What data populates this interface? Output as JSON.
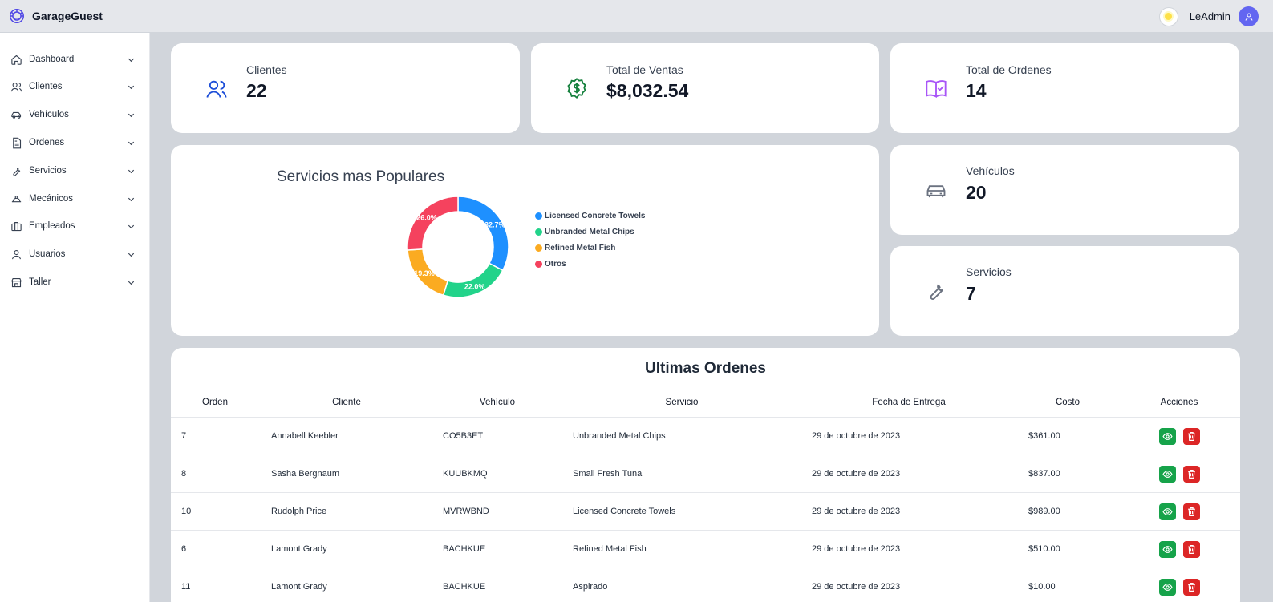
{
  "app": {
    "name": "GarageGuest"
  },
  "header": {
    "user_name": "LeAdmin"
  },
  "sidebar": {
    "items": [
      {
        "label": "Dashboard",
        "icon": "home-icon"
      },
      {
        "label": "Clientes",
        "icon": "users-icon"
      },
      {
        "label": "Vehículos",
        "icon": "car-icon"
      },
      {
        "label": "Ordenes",
        "icon": "document-icon"
      },
      {
        "label": "Servicios",
        "icon": "wrench-icon"
      },
      {
        "label": "Mecánicos",
        "icon": "hard-hat-icon"
      },
      {
        "label": "Empleados",
        "icon": "briefcase-icon"
      },
      {
        "label": "Usuarios",
        "icon": "user-icon"
      },
      {
        "label": "Taller",
        "icon": "store-icon"
      }
    ]
  },
  "stats": {
    "clientes": {
      "label": "Clientes",
      "value": "22",
      "icon": "users-icon",
      "color": "#1d4ed8"
    },
    "ventas": {
      "label": "Total de Ventas",
      "value": "$8,032.54",
      "icon": "dollar-badge-icon",
      "color": "#15803d"
    },
    "ordenes": {
      "label": "Total de Ordenes",
      "value": "14",
      "icon": "book-check-icon",
      "color": "#a855f7"
    },
    "vehiculos": {
      "label": "Vehículos",
      "value": "20",
      "icon": "car-icon",
      "color": "#6b7280"
    },
    "servicios": {
      "label": "Servicios",
      "value": "7",
      "icon": "wrench-icon",
      "color": "#6b7280"
    }
  },
  "chart_data": {
    "type": "pie",
    "title": "Servicios mas Populares",
    "donut": true,
    "legend_position": "right",
    "categories": [
      "Licensed Concrete Towels",
      "Unbranded Metal Chips",
      "Refined Metal Fish",
      "Otros"
    ],
    "values": [
      32.7,
      22.0,
      19.3,
      26.0
    ],
    "labels": [
      "32.7%",
      "22.0%",
      "19.3%",
      "26.0%"
    ],
    "colors": [
      "#1e90ff",
      "#22d38a",
      "#fbab21",
      "#f5425e"
    ]
  },
  "orders": {
    "title": "Ultimas Ordenes",
    "columns": [
      "Orden",
      "Cliente",
      "Vehículo",
      "Servicio",
      "Fecha de Entrega",
      "Costo",
      "Acciones"
    ],
    "rows": [
      {
        "orden": "7",
        "cliente": "Annabell Keebler",
        "vehiculo": "CO5B3ET",
        "servicio": "Unbranded Metal Chips",
        "fecha": "29 de octubre de 2023",
        "costo": "$361.00"
      },
      {
        "orden": "8",
        "cliente": "Sasha Bergnaum",
        "vehiculo": "KUUBKMQ",
        "servicio": "Small Fresh Tuna",
        "fecha": "29 de octubre de 2023",
        "costo": "$837.00"
      },
      {
        "orden": "10",
        "cliente": "Rudolph Price",
        "vehiculo": "MVRWBND",
        "servicio": "Licensed Concrete Towels",
        "fecha": "29 de octubre de 2023",
        "costo": "$989.00"
      },
      {
        "orden": "6",
        "cliente": "Lamont Grady",
        "vehiculo": "BACHKUE",
        "servicio": "Refined Metal Fish",
        "fecha": "29 de octubre de 2023",
        "costo": "$510.00"
      },
      {
        "orden": "11",
        "cliente": "Lamont Grady",
        "vehiculo": "BACHKUE",
        "servicio": "Aspirado",
        "fecha": "29 de octubre de 2023",
        "costo": "$10.00"
      }
    ]
  }
}
